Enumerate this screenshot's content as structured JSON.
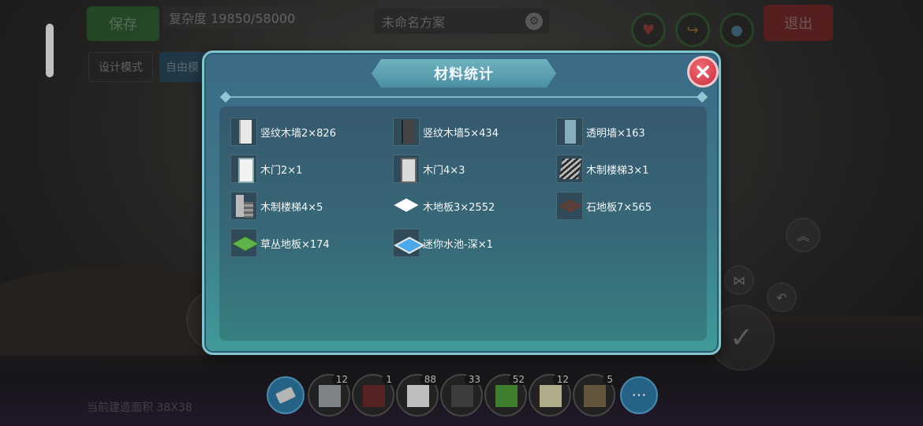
{
  "hud": {
    "save_label": "保存",
    "complexity": "复杂度 19850/58000",
    "design_mode": "设计模式",
    "free_mode": "自由模",
    "plan_name": "未命名方案",
    "exit_label": "退出",
    "build_area": "当前建造面积 38X38"
  },
  "toolbar": {
    "more_label": "···",
    "slots": [
      {
        "count": "12",
        "color": "#9aa0a6"
      },
      {
        "count": "1",
        "color": "#6a2b2b"
      },
      {
        "count": "88",
        "color": "#e8e8e8"
      },
      {
        "count": "33",
        "color": "#4a4a4a"
      },
      {
        "count": "52",
        "color": "#4f9a3a"
      },
      {
        "count": "12",
        "color": "#d7d2a8"
      },
      {
        "count": "5",
        "color": "#7a6a4a"
      }
    ]
  },
  "modal": {
    "title": "材料统计",
    "items": [
      {
        "label": "竖纹木墙2×826",
        "icon": "light-wall-icon"
      },
      {
        "label": "竖纹木墙5×434",
        "icon": "dark-wall-icon"
      },
      {
        "label": "透明墙×163",
        "icon": "glass-wall-icon"
      },
      {
        "label": "木门2×1",
        "icon": "white-door-icon"
      },
      {
        "label": "木门4×3",
        "icon": "gray-door-icon"
      },
      {
        "label": "木制楼梯3×1",
        "icon": "stairs-icon"
      },
      {
        "label": "木制楼梯4×5",
        "icon": "stairs-column-icon"
      },
      {
        "label": "木地板3×2552",
        "icon": "white-floor-icon"
      },
      {
        "label": "石地板7×565",
        "icon": "stone-floor-icon"
      },
      {
        "label": "草丛地板×174",
        "icon": "grass-floor-icon"
      },
      {
        "label": "迷你水池-深×1",
        "icon": "pool-icon"
      }
    ]
  }
}
